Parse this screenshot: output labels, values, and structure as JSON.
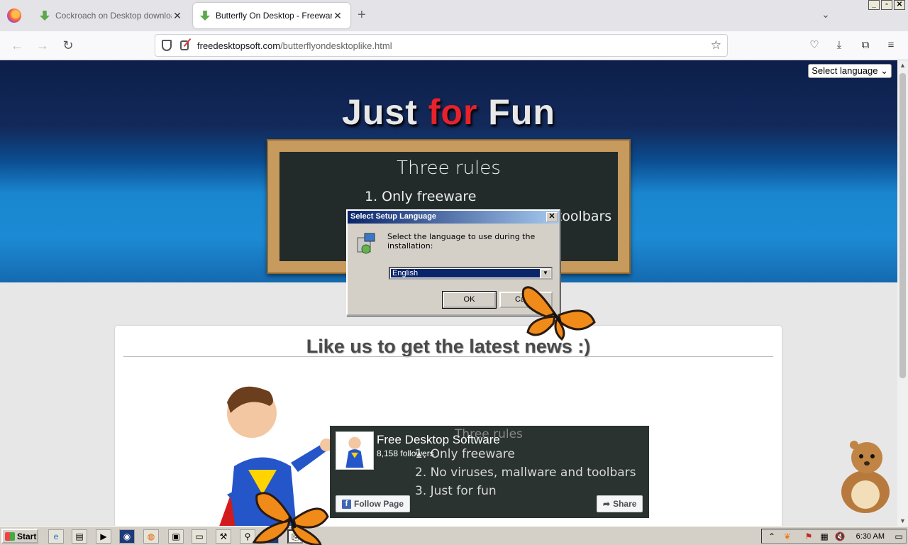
{
  "window": {
    "controls": [
      "_",
      "▫",
      "✕"
    ]
  },
  "tabs": [
    {
      "title": "Cockroach on Desktop download :",
      "active": false
    },
    {
      "title": "Butterfly On Desktop - Freeware e",
      "active": true
    }
  ],
  "tabstrip": {
    "new_tab": "+",
    "list_all": "⌄"
  },
  "urlbar": {
    "host": "freedesktopsoft.com",
    "path": "/butterflyondesktoplike.html"
  },
  "page": {
    "language_select": "Select language ⌄",
    "hero_title_part1": "Just ",
    "hero_title_for": "for",
    "hero_title_part3": " Fun",
    "board": {
      "title": "Three rules",
      "rule1": "1. Only freeware",
      "rule2": "2. No viruses, mallware and toolbars"
    },
    "like_title": "Like us to get the latest news :)",
    "fb": {
      "page_name": "Free Desktop Software",
      "followers": "8,158 followers",
      "follow_label": "Follow Page",
      "share_label": "Share",
      "board_title": "Three rules",
      "board_rule1": "1. Only freeware",
      "board_rule2": "2. No viruses, mallware and toolbars",
      "board_rule3": "3. Just for fun"
    }
  },
  "dialog": {
    "title": "Select Setup Language",
    "message": "Select the language to use during the installation:",
    "selected_language": "English",
    "ok_label": "OK",
    "cancel_label": "Ca"
  },
  "taskbar": {
    "start_label": "Start",
    "clock": "6:30 AM"
  },
  "colors": {
    "hero_top": "#0c1f4a",
    "hero_bottom": "#1c8ad4",
    "for_red": "#e8222a",
    "dialog_title": "#0a246a"
  }
}
